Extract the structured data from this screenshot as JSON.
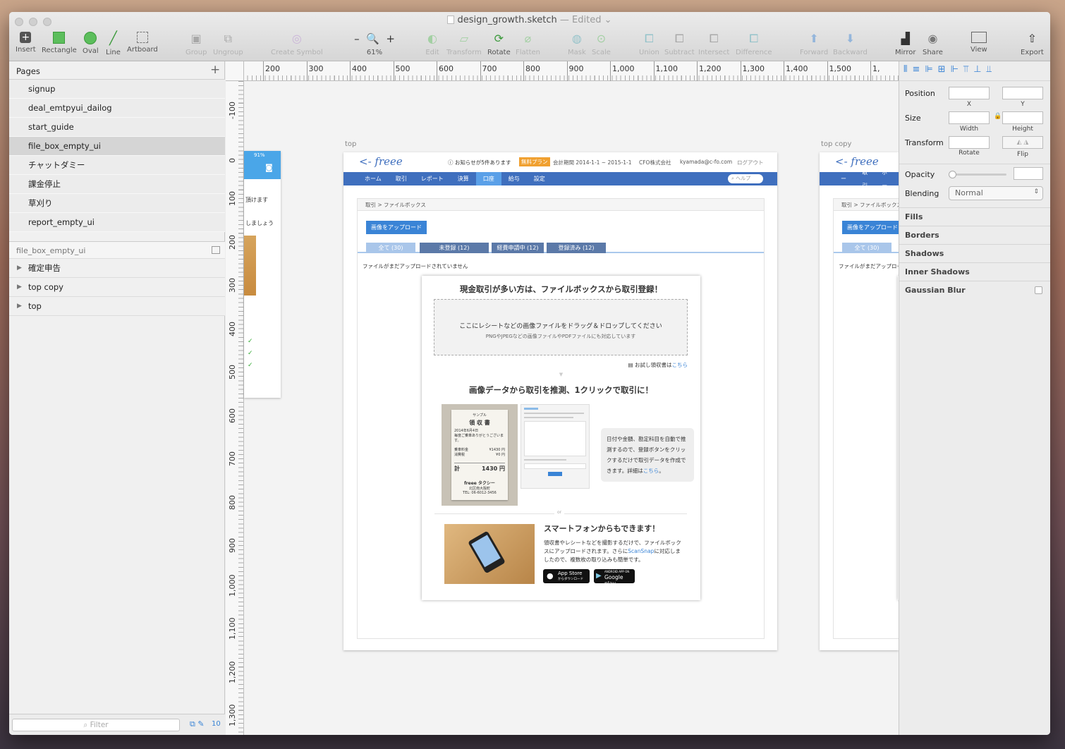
{
  "window": {
    "title": "design_growth.sketch",
    "edited": "— Edited ⌄"
  },
  "toolbar": {
    "insert": "Insert",
    "rectangle": "Rectangle",
    "oval": "Oval",
    "line": "Line",
    "artboard": "Artboard",
    "group": "Group",
    "ungroup": "Ungroup",
    "create_symbol": "Create Symbol",
    "zoom_value": "61%",
    "zoom_minus": "–",
    "zoom_plus": "+",
    "edit": "Edit",
    "transform": "Transform",
    "rotate": "Rotate",
    "flatten": "Flatten",
    "mask": "Mask",
    "scale": "Scale",
    "union": "Union",
    "subtract": "Subtract",
    "intersect": "Intersect",
    "difference": "Difference",
    "forward": "Forward",
    "backward": "Backward",
    "mirror": "Mirror",
    "share": "Share",
    "view": "View",
    "export": "Export"
  },
  "pages_panel": {
    "header": "Pages",
    "add": "+",
    "pages": [
      {
        "label": "signup",
        "selected": false
      },
      {
        "label": "deal_emtpyui_dailog",
        "selected": false
      },
      {
        "label": "start_guide",
        "selected": false
      },
      {
        "label": "file_box_empty_ui",
        "selected": true
      },
      {
        "label": "チャットダミー",
        "selected": false
      },
      {
        "label": "課金停止",
        "selected": false
      },
      {
        "label": "草刈り",
        "selected": false
      },
      {
        "label": "report_empty_ui",
        "selected": false
      }
    ],
    "current_page": "file_box_empty_ui",
    "layers": [
      {
        "label": "確定申告"
      },
      {
        "label": "top copy"
      },
      {
        "label": "top"
      }
    ],
    "filter_placeholder": "Filter",
    "count": "10"
  },
  "canvas": {
    "h_ticks": [
      "200",
      "300",
      "400",
      "500",
      "600",
      "700",
      "800",
      "900",
      "1,000",
      "1,100",
      "1,200",
      "1,300",
      "1,400",
      "1,500",
      "1,"
    ],
    "v_ticks": [
      "-100",
      "0",
      "100",
      "200",
      "300",
      "400",
      "500",
      "600",
      "700",
      "800",
      "900",
      "1,000",
      "1,100",
      "1,200",
      "1,300"
    ],
    "artboard_labels": {
      "top": "top",
      "top_copy": "top copy"
    },
    "phone": {
      "status": "91%",
      "line1": "頂けます",
      "line2": "しましょう"
    },
    "freee": {
      "logo": "freee",
      "notice": "お知らせが5件あります",
      "plan_badge": "無料プラン",
      "period": "会計期間 2014-1-1 ~ 2015-1-1",
      "company": "CFO株式会社",
      "email": "kyamada@c-fo.com",
      "logout": "ログアウト",
      "nav": [
        "ホーム",
        "取引",
        "レポート",
        "決算",
        "口座",
        "給与",
        "設定"
      ],
      "nav_active_index": 4,
      "help": "ヘルプ",
      "breadcrumb": "取引 > ファイルボックス",
      "upload_button": "画像をアップロード",
      "tabs": [
        "全て (30)",
        "未登録 (12)",
        "経費申請中 (12)",
        "登録済み (12)"
      ],
      "empty_msg": "ファイルがまだアップロードされていません",
      "card_title": "現金取引が多い方は、ファイルボックスから取引登録！",
      "drop_main": "ここにレシートなどの画像ファイルをドラッグ＆ドロップしてください",
      "drop_sub": "PNGやJPEGなどの画像ファイルやPDFファイルにも対応しています",
      "sample_link_prefix": "お試し領収書は",
      "sample_link": "こちら",
      "section2_title": "画像データから取引を推測、1クリックで取引に！",
      "receipt": {
        "sample": "サンプル",
        "title": "領 収 書",
        "date": "2014年6月4日",
        "thanks": "毎度ご乗車ありがとうございます。",
        "fare_label": "乗車料金",
        "fare": "¥1430 円",
        "tax_label": "消費税",
        "tax": "¥0 円",
        "total_label": "計",
        "total": "1430",
        "total_unit": "円",
        "company": "freee タクシー",
        "address": "北区南大阪町",
        "tel": "TEL: 06-6012-3456"
      },
      "bubble_text": "日付や金額、勘定科目を自動で推測するので、登録ボタンをクリックするだけで取引データを作成できます。詳細は",
      "bubble_link": "こちら",
      "bubble_end": "。",
      "or": "or",
      "section3_title": "スマートフォンからもできます！",
      "section3_text1": "領収書やレシートなどを撮影するだけで、ファイルボックスにアップロードされます。さらに",
      "section3_link": "ScanSnap",
      "section3_text2": "に対応しましたので、複数枚の取り込みも簡単です。",
      "appstore_small": "App Store",
      "appstore_sub": "からダウンロード",
      "gplay_small": "ANDROID APP ON",
      "gplay": "Google play"
    }
  },
  "inspector": {
    "position": "Position",
    "x": "X",
    "y": "Y",
    "size": "Size",
    "width": "Width",
    "height": "Height",
    "transform": "Transform",
    "rotate": "Rotate",
    "flip": "Flip",
    "opacity": "Opacity",
    "blending": "Blending",
    "blending_value": "Normal",
    "sections": [
      "Fills",
      "Borders",
      "Shadows",
      "Inner Shadows",
      "Gaussian Blur"
    ]
  },
  "colors": {
    "freee_blue": "#3f6fbe",
    "active_tab": "#5aa0e8",
    "badge_orange": "#f0a030"
  }
}
